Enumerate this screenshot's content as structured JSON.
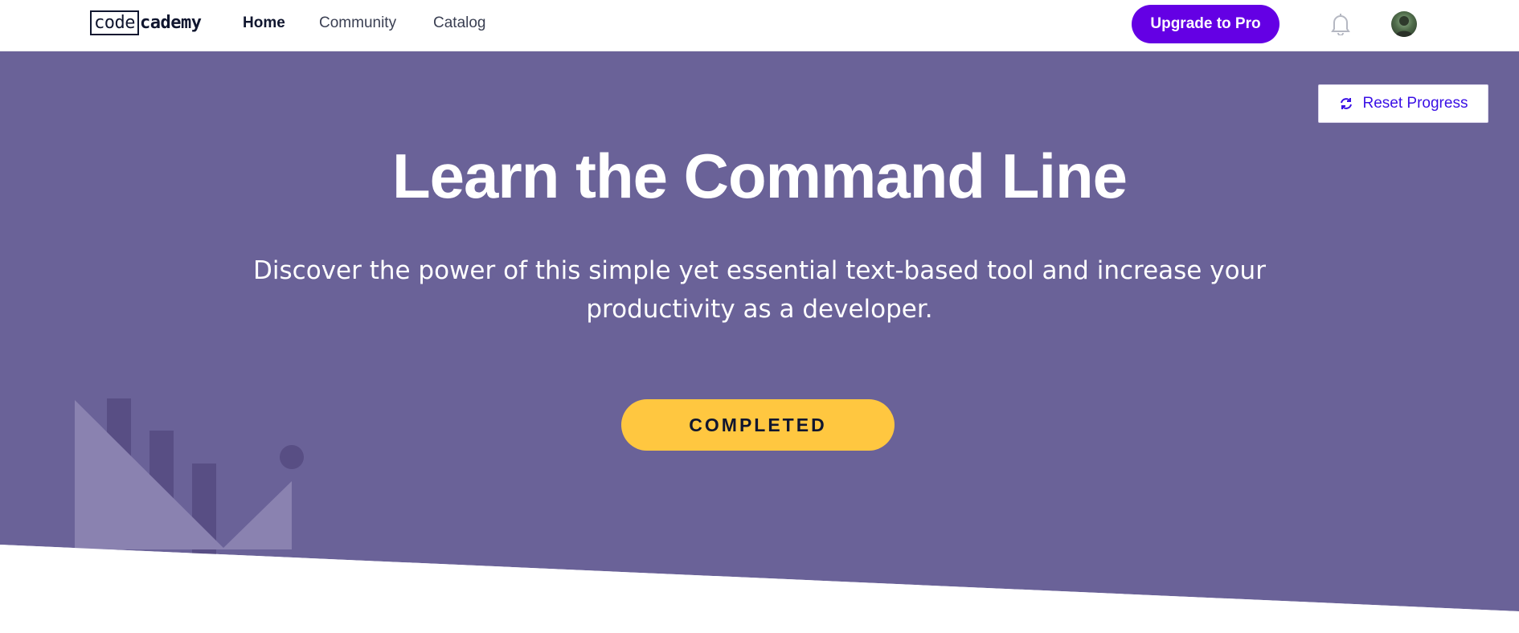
{
  "brand": {
    "logo_boxed": "code",
    "logo_rest": "cademy"
  },
  "nav": {
    "links": [
      {
        "label": "Home",
        "active": true
      },
      {
        "label": "Community",
        "active": false
      },
      {
        "label": "Catalog",
        "active": false
      }
    ],
    "upgrade_label": "Upgrade to Pro",
    "icons": {
      "notifications": "bell-icon",
      "profile": "user-avatar"
    }
  },
  "hero": {
    "reset_label": "Reset Progress",
    "reset_icon": "refresh-icon",
    "title": "Learn the Command Line",
    "description": "Discover the power of this simple yet essential text-based tool and increase your productivity as a developer.",
    "status_label": "COMPLETED"
  },
  "colors": {
    "nav_bg": "#ffffff",
    "hero_bg": "#6a6298",
    "accent_purple": "#6400e4",
    "reset_text": "#3a10e5",
    "completed_yellow": "#ffc740",
    "text_dark": "#10162f"
  }
}
